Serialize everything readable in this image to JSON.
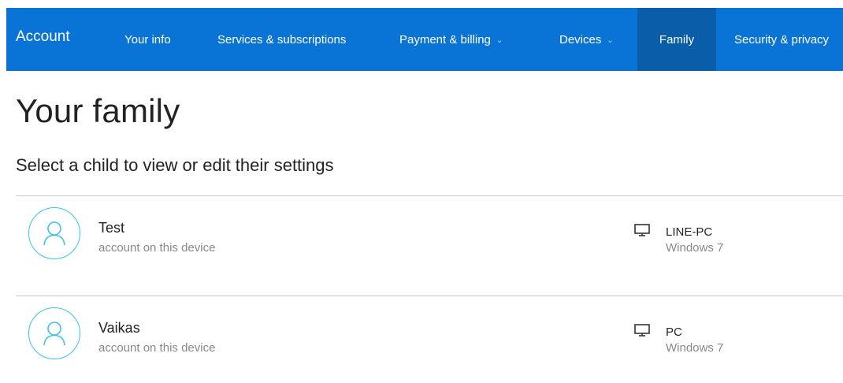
{
  "header": {
    "brand": "Account",
    "nav": [
      {
        "label": "Your info",
        "has_dropdown": false,
        "active": false
      },
      {
        "label": "Services & subscriptions",
        "has_dropdown": false,
        "active": false
      },
      {
        "label": "Payment & billing",
        "has_dropdown": true,
        "active": false
      },
      {
        "label": "Devices",
        "has_dropdown": true,
        "active": false
      },
      {
        "label": "Family",
        "has_dropdown": false,
        "active": true
      },
      {
        "label": "Security & privacy",
        "has_dropdown": false,
        "active": false
      }
    ],
    "dropdown_glyph": "⌄"
  },
  "main": {
    "title": "Your family",
    "subtitle": "Select a child to view or edit their settings",
    "children": [
      {
        "name": "Test",
        "account_type": "account on this device",
        "avatar_icon": "person-icon",
        "device": {
          "name": "LINE-PC",
          "os": "Windows 7",
          "icon": "monitor-icon"
        }
      },
      {
        "name": "Vaikas",
        "account_type": "account on this device",
        "avatar_icon": "person-icon",
        "device": {
          "name": "PC",
          "os": "Windows 7",
          "icon": "monitor-icon"
        }
      }
    ]
  },
  "colors": {
    "nav_background": "#0a74d6",
    "nav_active_background": "#0a5ea9",
    "avatar_ring": "#3cc2e6",
    "secondary_text": "#888888"
  }
}
